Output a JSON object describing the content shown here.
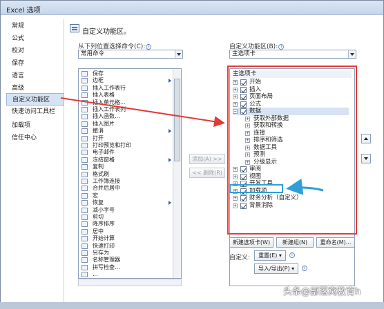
{
  "window": {
    "title": "Excel 选项"
  },
  "sidebar": {
    "items": [
      {
        "label": "常规"
      },
      {
        "label": "公式"
      },
      {
        "label": "校对"
      },
      {
        "label": "保存"
      },
      {
        "label": "语言"
      },
      {
        "label": "高级"
      },
      {
        "label": "自定义功能区",
        "selected": true
      },
      {
        "label": "快速访问工具栏"
      },
      {
        "label": "加载项"
      },
      {
        "label": "信任中心"
      }
    ]
  },
  "main": {
    "heading": "自定义功能区。",
    "choose_label": "从下列位置选择命令(C):",
    "choose_value": "常用命令",
    "customize_label": "自定义功能区(B):",
    "customize_value": "主选项卡",
    "info_icon": "i",
    "commands": [
      {
        "label": "保存"
      },
      {
        "label": "边框",
        "submenu": true
      },
      {
        "label": "插入工作表行"
      },
      {
        "label": "插入表格"
      },
      {
        "label": "插入单元格..."
      },
      {
        "label": "插入工作表列"
      },
      {
        "label": "插入函数..."
      },
      {
        "label": "插入图片"
      },
      {
        "label": "撤消",
        "submenu": true
      },
      {
        "label": "打开"
      },
      {
        "label": "打印预览和打印"
      },
      {
        "label": "电子邮件"
      },
      {
        "label": "冻结窗格",
        "submenu": true
      },
      {
        "label": "复制"
      },
      {
        "label": "格式刷"
      },
      {
        "label": "工作簿连接"
      },
      {
        "label": "合并后居中"
      },
      {
        "label": "宏"
      },
      {
        "label": "恢复",
        "submenu": true
      },
      {
        "label": "减小字号"
      },
      {
        "label": "剪切"
      },
      {
        "label": "降序排序"
      },
      {
        "label": "居中"
      },
      {
        "label": "开始计算"
      },
      {
        "label": "快速打印"
      },
      {
        "label": "另存为"
      },
      {
        "label": "名称管理器"
      },
      {
        "label": "拼写检查..."
      },
      {
        "label": "..."
      }
    ],
    "add_button": "添加(A) >>",
    "remove_button": "<< 删除(R)",
    "tree_header": "主选项卡",
    "tree": [
      {
        "label": "开始",
        "level": 0,
        "expander": "+",
        "checked": true
      },
      {
        "label": "插入",
        "level": 0,
        "expander": "+",
        "checked": true
      },
      {
        "label": "页面布局",
        "level": 0,
        "expander": "+",
        "checked": true
      },
      {
        "label": "公式",
        "level": 0,
        "expander": "+",
        "checked": true
      },
      {
        "label": "数据",
        "level": 0,
        "expander": "−",
        "checked": true,
        "selected": true
      },
      {
        "label": "获取外部数据",
        "level": 1,
        "expander": "+"
      },
      {
        "label": "获取和转换",
        "level": 1,
        "expander": "+"
      },
      {
        "label": "连接",
        "level": 1,
        "expander": "+"
      },
      {
        "label": "排序和筛选",
        "level": 1,
        "expander": "+"
      },
      {
        "label": "数据工具",
        "level": 1,
        "expander": "+"
      },
      {
        "label": "预测",
        "level": 1,
        "expander": "+"
      },
      {
        "label": "分级显示",
        "level": 1,
        "expander": "+"
      },
      {
        "label": "审阅",
        "level": 0,
        "expander": "+",
        "checked": true
      },
      {
        "label": "视图",
        "level": 0,
        "expander": "+",
        "checked": true
      },
      {
        "label": "开发工具",
        "level": 0,
        "expander": "+",
        "checked": true
      },
      {
        "label": "加载项",
        "level": 0,
        "expander": "+",
        "checked": true
      },
      {
        "label": "财务分析（自定义）",
        "level": 0,
        "expander": "+",
        "checked": true
      },
      {
        "label": "背景消除",
        "level": 0,
        "expander": "+",
        "checked": true
      }
    ],
    "new_tab_button": "新建选项卡(W)",
    "new_group_button": "新建组(N)",
    "rename_button": "重命名(M)...",
    "customizations_label": "自定义:",
    "reset_button": "重置(E) ▾",
    "import_export_button": "导入/导出(P) ▾"
  },
  "watermark": "头条@部落窝教育h",
  "colors": {
    "highlight_red": "#e53935",
    "highlight_blue": "#2e9fd8",
    "selection": "#d5e3f4"
  }
}
